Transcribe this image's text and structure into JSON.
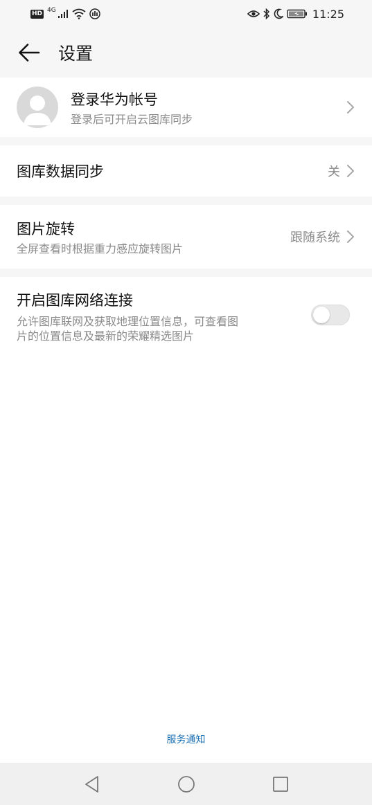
{
  "status": {
    "hd": "HD",
    "net": "4G",
    "time": "11:25",
    "icons": [
      "signal-icon",
      "wifi-icon",
      "data-icon",
      "eye-comfort-icon",
      "bluetooth-icon",
      "moon-icon",
      "battery-icon"
    ]
  },
  "header": {
    "back_icon": "arrow-left-icon",
    "title": "设置"
  },
  "account": {
    "title": "登录华为帐号",
    "subtitle": "登录后可开启云图库同步"
  },
  "sync": {
    "title": "图库数据同步",
    "value": "关"
  },
  "rotate": {
    "title": "图片旋转",
    "subtitle": "全屏查看时根据重力感应旋转图片",
    "value": "跟随系统"
  },
  "network": {
    "title": "开启图库网络连接",
    "subtitle_line1": "允许图库联网及获取地理位置信息，可查看图",
    "subtitle_line2": "片的位置信息及最新的荣耀精选图片",
    "enabled": false
  },
  "footer": {
    "service_notice": "服务通知"
  },
  "colors": {
    "background": "#f6f6f6",
    "card": "#ffffff",
    "text_primary": "#111111",
    "text_secondary": "#8a8a8a",
    "link": "#1a6fb2"
  },
  "navbar": {
    "icons": [
      "back-triangle-icon",
      "home-circle-icon",
      "recents-square-icon"
    ]
  }
}
